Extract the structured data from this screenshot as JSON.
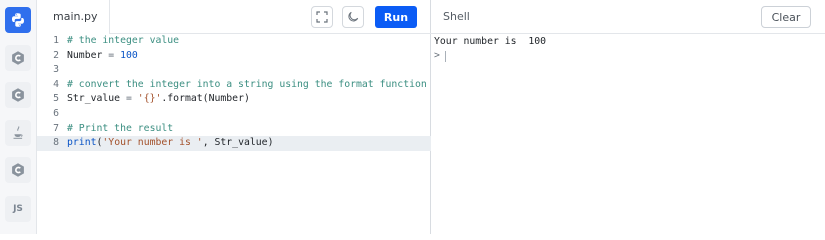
{
  "sidebar": {
    "items": [
      {
        "name": "python-icon",
        "active": true
      },
      {
        "name": "c-icon",
        "active": false
      },
      {
        "name": "cpp-icon",
        "active": false
      },
      {
        "name": "java-icon",
        "active": false
      },
      {
        "name": "csharp-icon",
        "active": false
      },
      {
        "name": "js-icon",
        "label": "JS",
        "active": false
      }
    ]
  },
  "editor": {
    "tab_label": "main.py",
    "run_label": "Run",
    "fullscreen_icon": "fullscreen-icon",
    "theme_icon": "moon-icon",
    "current_line": 8,
    "lines": [
      {
        "num": "1",
        "tokens": [
          {
            "t": "# the integer value",
            "k": "comment"
          }
        ]
      },
      {
        "num": "2",
        "tokens": [
          {
            "t": "Number",
            "k": "plain"
          },
          {
            "t": " = ",
            "k": "op"
          },
          {
            "t": "100",
            "k": "number"
          }
        ]
      },
      {
        "num": "3",
        "tokens": []
      },
      {
        "num": "4",
        "tokens": [
          {
            "t": "# convert the integer into a string using the format function",
            "k": "comment"
          }
        ]
      },
      {
        "num": "5",
        "tokens": [
          {
            "t": "Str_value",
            "k": "plain"
          },
          {
            "t": " = ",
            "k": "op"
          },
          {
            "t": "'{}'",
            "k": "string"
          },
          {
            "t": ".format(Number)",
            "k": "plain"
          }
        ]
      },
      {
        "num": "6",
        "tokens": []
      },
      {
        "num": "7",
        "tokens": [
          {
            "t": "# Print the result",
            "k": "comment"
          }
        ]
      },
      {
        "num": "8",
        "tokens": [
          {
            "t": "print",
            "k": "func"
          },
          {
            "t": "(",
            "k": "plain"
          },
          {
            "t": "'Your number is '",
            "k": "string"
          },
          {
            "t": ", Str_value)",
            "k": "plain"
          }
        ]
      }
    ]
  },
  "shell": {
    "title": "Shell",
    "clear_label": "Clear",
    "output": "Your number is  100",
    "prompt": ">"
  },
  "colors": {
    "accent": "#0b5cf5",
    "active_lang": "#2f6fed"
  }
}
